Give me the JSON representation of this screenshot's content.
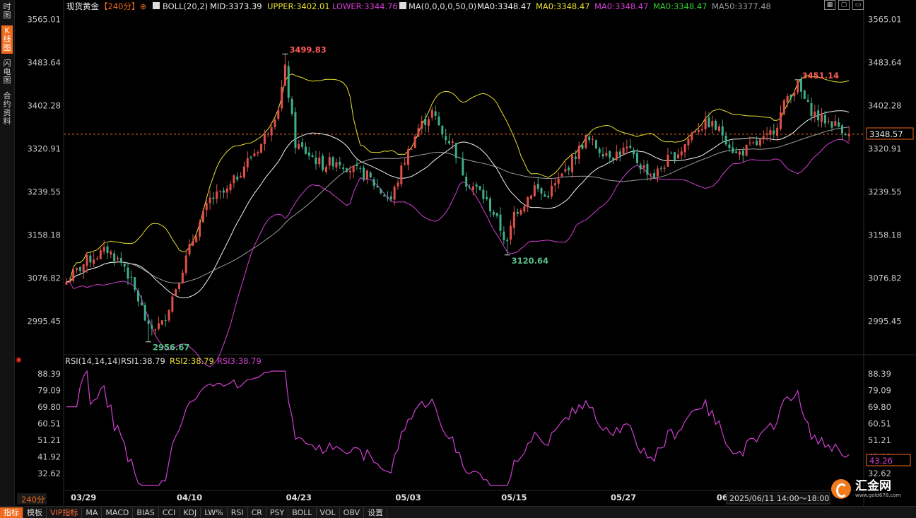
{
  "side_tabs": [
    {
      "label": "时图",
      "active": false
    },
    {
      "label": "K线图",
      "active": true
    },
    {
      "label": "闪电图",
      "active": false
    },
    {
      "label": "合约资料",
      "active": false
    }
  ],
  "header": {
    "symbol": "现货黄金",
    "period": "【240分】",
    "boll": "BOLL(20,2)",
    "mid": "MID:3373.39",
    "upper": "UPPER:3402.01",
    "lower": "LOWER:3344.76",
    "ma_params": "MA(0,0,0,0,50,0)",
    "ma1": "MA0:3348.47",
    "ma2": "MA0:3348.47",
    "ma3": "MA0:3348.47",
    "ma4": "MA0:3348.47",
    "ma50": "MA50:3377.48"
  },
  "rsi_header": {
    "params": "RSI(14,14,14)",
    "rsi1": "RSI1:38.79",
    "rsi2": "RSI2:38.79",
    "rsi3": "RSI3:38.79"
  },
  "colors": {
    "up": "#e0504a",
    "down": "#3fae8a",
    "upper": "#e8e030",
    "mid": "#f2f2f2",
    "lower": "#d23fd2",
    "ma50": "#9a9a9a",
    "rsi": "#d23fd2",
    "accent": "#f06a1c"
  },
  "current_price": "3348.57",
  "rsi_current": "43.26",
  "timestamp": "2025/06/11 14:00～18:00",
  "period_label": "240分",
  "bottom_tabs": [
    {
      "label": "指标",
      "active": true,
      "vip": false
    },
    {
      "label": "模板",
      "active": false,
      "vip": false
    },
    {
      "label": "VIP指标",
      "active": false,
      "vip": true
    },
    {
      "label": "MA",
      "active": false,
      "vip": false
    },
    {
      "label": "MACD",
      "active": false,
      "vip": false
    },
    {
      "label": "BIAS",
      "active": false,
      "vip": false
    },
    {
      "label": "CCI",
      "active": false,
      "vip": false
    },
    {
      "label": "KDJ",
      "active": false,
      "vip": false
    },
    {
      "label": "LW%",
      "active": false,
      "vip": false
    },
    {
      "label": "RSI",
      "active": false,
      "vip": false
    },
    {
      "label": "CR",
      "active": false,
      "vip": false
    },
    {
      "label": "PSY",
      "active": false,
      "vip": false
    },
    {
      "label": "BOLL",
      "active": false,
      "vip": false
    },
    {
      "label": "VOL",
      "active": false,
      "vip": false
    },
    {
      "label": "OBV",
      "active": false,
      "vip": false
    },
    {
      "label": "设置",
      "active": false,
      "vip": false
    }
  ],
  "brand": {
    "name": "汇金网",
    "url": "www.gold678.com"
  },
  "chart_data": [
    {
      "type": "candlestick",
      "title": "现货黄金【240分】",
      "y_ticks": [
        3565.01,
        3483.64,
        3402.28,
        3320.91,
        3239.55,
        3158.18,
        3076.82,
        2995.45
      ],
      "ylim": [
        2935,
        3575
      ],
      "x_ticks": [
        {
          "label": "03/29",
          "index": 5
        },
        {
          "label": "04/10",
          "index": 36
        },
        {
          "label": "04/23",
          "index": 68
        },
        {
          "label": "05/03",
          "index": 100
        },
        {
          "label": "05/15",
          "index": 131
        },
        {
          "label": "05/27",
          "index": 163
        },
        {
          "label": "06/06",
          "index": 194
        }
      ],
      "n_bars": 230,
      "annotations": [
        {
          "text": "3499.83",
          "index": 64,
          "value": 3499.83,
          "kind": "high"
        },
        {
          "text": "3451.14",
          "index": 214,
          "value": 3451.14,
          "kind": "high"
        },
        {
          "text": "3120.64",
          "index": 129,
          "value": 3120.64,
          "kind": "low"
        },
        {
          "text": "2956.67",
          "index": 24,
          "value": 2956.67,
          "kind": "low"
        }
      ],
      "close_anchors": [
        [
          0,
          3070
        ],
        [
          6,
          3110
        ],
        [
          12,
          3130
        ],
        [
          17,
          3100
        ],
        [
          22,
          3020
        ],
        [
          24,
          2980
        ],
        [
          28,
          2990
        ],
        [
          32,
          3060
        ],
        [
          37,
          3150
        ],
        [
          42,
          3225
        ],
        [
          47,
          3240
        ],
        [
          52,
          3290
        ],
        [
          57,
          3330
        ],
        [
          62,
          3400
        ],
        [
          64,
          3470
        ],
        [
          67,
          3330
        ],
        [
          71,
          3310
        ],
        [
          75,
          3290
        ],
        [
          79,
          3300
        ],
        [
          84,
          3280
        ],
        [
          88,
          3270
        ],
        [
          92,
          3240
        ],
        [
          95,
          3225
        ],
        [
          99,
          3300
        ],
        [
          103,
          3360
        ],
        [
          107,
          3390
        ],
        [
          110,
          3350
        ],
        [
          113,
          3330
        ],
        [
          117,
          3260
        ],
        [
          121,
          3240
        ],
        [
          125,
          3200
        ],
        [
          129,
          3140
        ],
        [
          131,
          3200
        ],
        [
          134,
          3220
        ],
        [
          137,
          3250
        ],
        [
          140,
          3230
        ],
        [
          144,
          3260
        ],
        [
          148,
          3300
        ],
        [
          152,
          3340
        ],
        [
          156,
          3320
        ],
        [
          160,
          3310
        ],
        [
          164,
          3320
        ],
        [
          168,
          3290
        ],
        [
          172,
          3270
        ],
        [
          176,
          3300
        ],
        [
          180,
          3320
        ],
        [
          184,
          3360
        ],
        [
          188,
          3370
        ],
        [
          192,
          3350
        ],
        [
          196,
          3310
        ],
        [
          199,
          3320
        ],
        [
          202,
          3330
        ],
        [
          205,
          3340
        ],
        [
          208,
          3370
        ],
        [
          211,
          3420
        ],
        [
          214,
          3440
        ],
        [
          217,
          3400
        ],
        [
          220,
          3380
        ],
        [
          224,
          3370
        ],
        [
          227,
          3360
        ],
        [
          229,
          3348.57
        ]
      ],
      "series": [
        {
          "name": "UPPER",
          "key": "upper"
        },
        {
          "name": "MID",
          "key": "mid"
        },
        {
          "name": "LOWER",
          "key": "lower"
        },
        {
          "name": "MA50",
          "key": "ma50"
        }
      ],
      "current_price": 3348.57
    },
    {
      "type": "line",
      "title": "RSI(14,14,14)",
      "y_ticks": [
        88.39,
        79.09,
        69.8,
        60.51,
        51.21,
        41.92,
        32.62
      ],
      "ylim": [
        24,
        92
      ],
      "series": [
        {
          "name": "RSI1",
          "key": "rsi"
        }
      ],
      "current_value": 43.26
    }
  ]
}
